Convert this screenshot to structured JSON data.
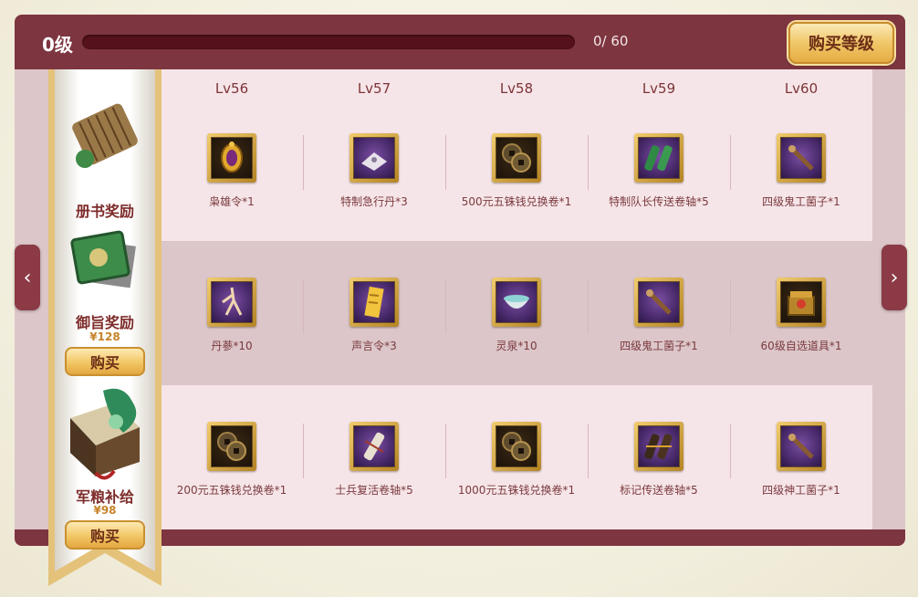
{
  "header": {
    "level_label": "0级",
    "progress_text": "0/ 60",
    "progress_fraction": 0,
    "buy_level_label": "购买等级"
  },
  "levels": [
    "Lv56",
    "Lv57",
    "Lv58",
    "Lv59",
    "Lv60"
  ],
  "rewards": [
    {
      "title": "册书奖励",
      "items": [
        {
          "name": "枭雄令*1",
          "icon": "golden-token-icon"
        },
        {
          "name": "特制急行丹*3",
          "icon": "pill-icon"
        },
        {
          "name": "500元五铢钱兑换卷*1",
          "icon": "coin-icon"
        },
        {
          "name": "特制队长传送卷轴*5",
          "icon": "scroll-pair-icon"
        },
        {
          "name": "四级鬼工菌子*1",
          "icon": "tool-icon"
        }
      ]
    },
    {
      "title": "御旨奖励",
      "price": "¥128",
      "buy_label": "购买",
      "items": [
        {
          "name": "丹蔘*10",
          "icon": "ginseng-icon"
        },
        {
          "name": "声言令*3",
          "icon": "decree-icon"
        },
        {
          "name": "灵泉*10",
          "icon": "bowl-icon"
        },
        {
          "name": "四级鬼工菌子*1",
          "icon": "tool-icon"
        },
        {
          "name": "60级自选道具*1",
          "icon": "chest-icon"
        }
      ]
    },
    {
      "title": "军粮补给",
      "price": "¥98",
      "buy_label": "购买",
      "items": [
        {
          "name": "200元五铢钱兑换卷*1",
          "icon": "coin-icon"
        },
        {
          "name": "士兵复活卷轴*5",
          "icon": "scroll-icon"
        },
        {
          "name": "1000元五铢钱兑换卷*1",
          "icon": "coin-icon"
        },
        {
          "name": "标记传送卷轴*5",
          "icon": "scroll-pair-icon"
        },
        {
          "name": "四级神工菌子*1",
          "icon": "tool-icon"
        }
      ]
    }
  ],
  "colors": {
    "panel": "#7d3540",
    "row_light": "#f6e5e8",
    "row_dark": "#dcc6c9",
    "gold": "#e9b94f",
    "text_red": "#7a3a3e"
  }
}
